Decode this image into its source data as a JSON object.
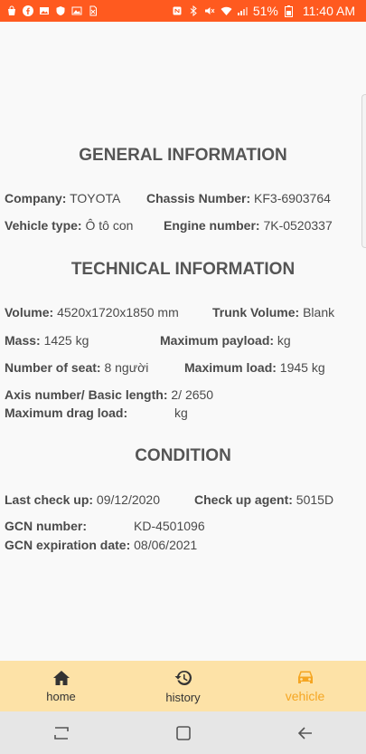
{
  "status_bar": {
    "time": "11:40 AM",
    "battery": "51%",
    "left_icons": [
      "bag-icon",
      "facebook-icon",
      "gallery-icon",
      "shield-icon",
      "photo-icon",
      "sim-off-icon"
    ],
    "right_icons": [
      "nfc-icon",
      "bluetooth-icon",
      "mute-icon",
      "wifi-icon",
      "signal-icon",
      "battery-icon"
    ]
  },
  "general": {
    "title": "GENERAL INFORMATION",
    "company_label": "Company:",
    "company_value": " TOYOTA",
    "chassis_label": "Chassis Number:",
    "chassis_value": " KF3-6903764",
    "vehicle_type_label": "Vehicle type:",
    "vehicle_type_value": " Ô tô con",
    "engine_label": "Engine number:",
    "engine_value": " 7K-0520337"
  },
  "technical": {
    "title": "TECHNICAL INFORMATION",
    "volume_label": "Volume:",
    "volume_value": " 4520x1720x1850 mm",
    "trunk_label": "Trunk Volume:",
    "trunk_value": " Blank",
    "mass_label": "Mass:",
    "mass_value": " 1425 kg",
    "payload_label": "Maximum payload:",
    "payload_value": " kg",
    "seat_label": "Number of seat:",
    "seat_value": " 8 người",
    "max_load_label": "Maximum load:",
    "max_load_value": " 1945 kg",
    "axis_label": "Axis number/ Basic length:",
    "axis_value": " 2/ 2650",
    "drag_label": "Maximum drag load:",
    "drag_value": "kg"
  },
  "condition": {
    "title": "CONDITION",
    "last_check_label": "Last check up:",
    "last_check_value": " 09/12/2020",
    "agent_label": "Check up agent:",
    "agent_value": " 5015D",
    "gcn_label": "GCN number:",
    "gcn_value": "KD-4501096",
    "gcn_exp_label": "GCN expiration date:",
    "gcn_exp_value": " 08/06/2021"
  },
  "bottom_nav": {
    "home": "home",
    "history": "history",
    "vehicle": "vehicle",
    "active_color": "#f5a623",
    "background": "#fde2a7"
  }
}
